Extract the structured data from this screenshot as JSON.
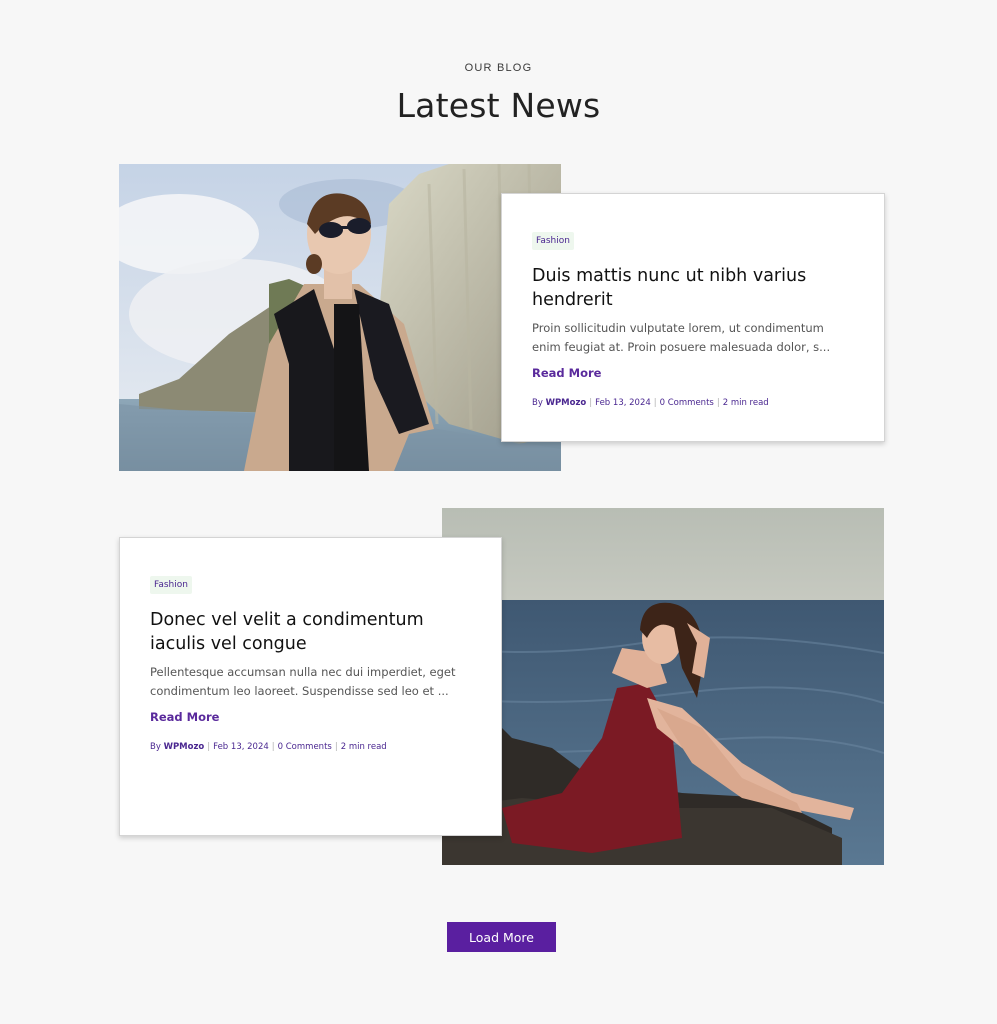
{
  "section": {
    "eyebrow": "OUR BLOG",
    "title": "Latest News"
  },
  "posts": [
    {
      "category": "Fashion",
      "title": "Duis mattis nunc ut nibh varius hendrerit",
      "excerpt": "Proin sollicitudin vulputate lorem, ut condimentum enim feugiat at. Proin posuere malesuada dolor, s...",
      "read_more": "Read More",
      "meta": {
        "by": "By",
        "author": "WPMozo",
        "date": "Feb 13, 2024",
        "comments": "0 Comments",
        "read_time": "2 min read"
      }
    },
    {
      "category": "Fashion",
      "title": "Donec vel velit a condimentum iaculis vel congue",
      "excerpt": "Pellentesque accumsan nulla nec dui imperdiet, eget condimentum leo laoreet. Suspendisse sed leo et ...",
      "read_more": "Read More",
      "meta": {
        "by": "By",
        "author": "WPMozo",
        "date": "Feb 13, 2024",
        "comments": "0 Comments",
        "read_time": "2 min read"
      }
    }
  ],
  "load_more_label": "Load More",
  "colors": {
    "accent": "#5a1fa0",
    "link": "#5a2a9c",
    "background": "#f7f7f7",
    "badge_bg": "#eef7ee"
  },
  "icons": {
    "post_1_image": "woman-sunglasses-cliffs-photo",
    "post_2_image": "woman-red-dress-sea-rocks-photo"
  }
}
